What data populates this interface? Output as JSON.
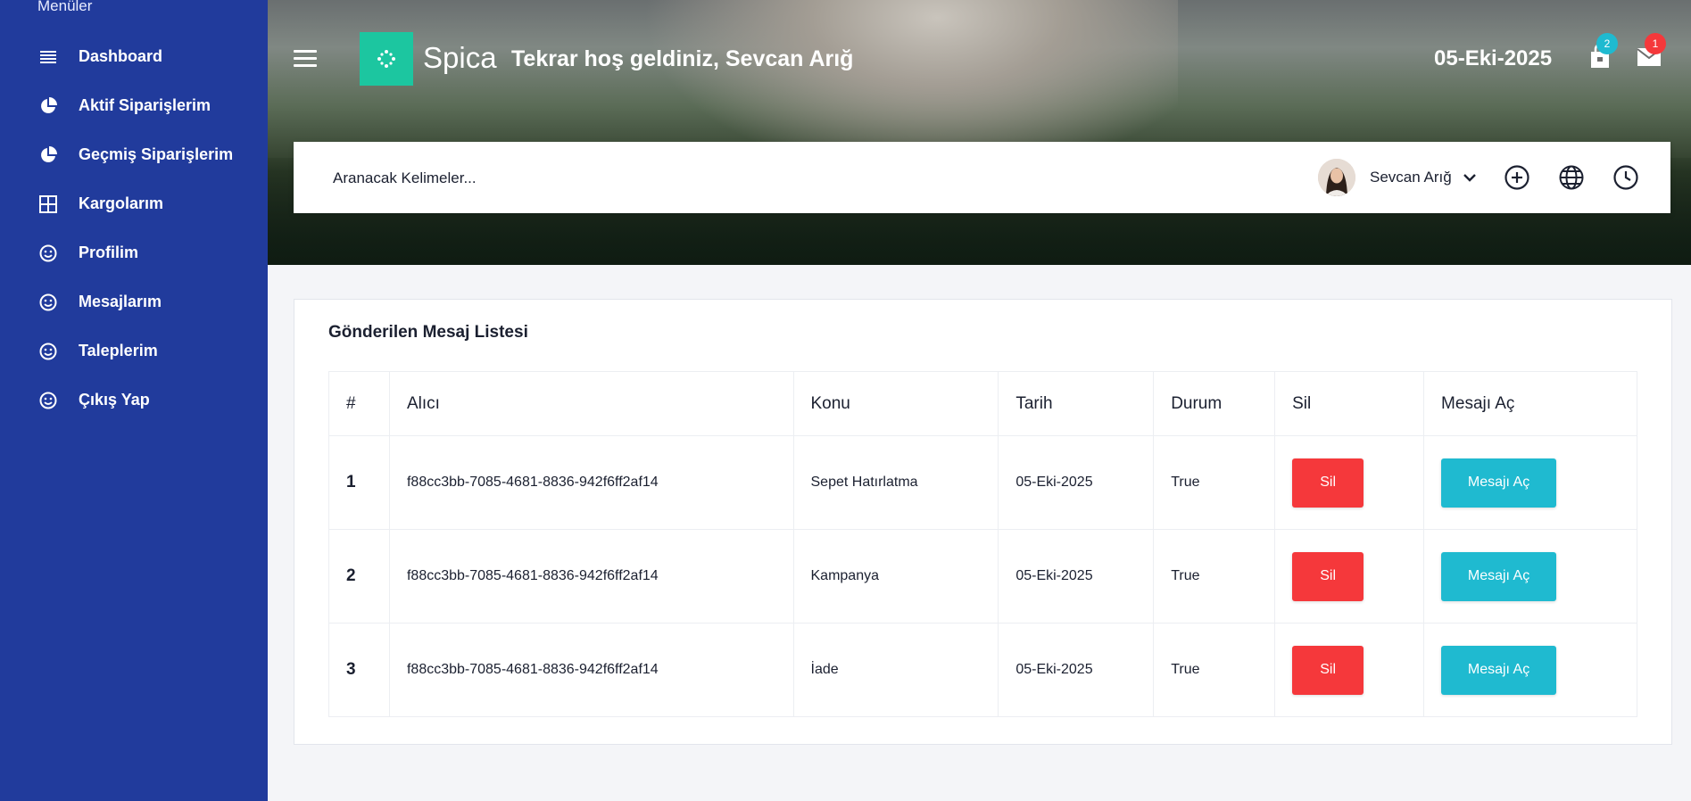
{
  "sidebar": {
    "title": "Menüler",
    "items": [
      {
        "label": "Dashboard",
        "icon": "list-icon"
      },
      {
        "label": "Aktif Siparişlerim",
        "icon": "pie-chart-icon"
      },
      {
        "label": "Geçmiş Siparişlerim",
        "icon": "pie-chart-icon"
      },
      {
        "label": "Kargolarım",
        "icon": "grid-icon"
      },
      {
        "label": "Profilim",
        "icon": "smile-icon"
      },
      {
        "label": "Mesajlarım",
        "icon": "smile-icon"
      },
      {
        "label": "Taleplerim",
        "icon": "smile-icon"
      },
      {
        "label": "Çıkış Yap",
        "icon": "smile-icon"
      }
    ]
  },
  "header": {
    "brand": "Spica",
    "welcome": "Tekrar hoş geldiniz, Sevcan Arığ",
    "date": "05-Eki-2025",
    "cart_badge": "2",
    "mail_badge": "1",
    "colors": {
      "brand_green": "#1cc6a0",
      "cart_badge": "#1fbad0",
      "mail_badge": "#f5383b"
    }
  },
  "search": {
    "placeholder": "Aranacak Kelimeler...",
    "user_name": "Sevcan Arığ"
  },
  "card": {
    "title": "Gönderilen Mesaj Listesi",
    "columns": [
      "#",
      "Alıcı",
      "Konu",
      "Tarih",
      "Durum",
      "Sil",
      "Mesajı Aç"
    ],
    "rows": [
      {
        "num": "1",
        "recipient": "f88cc3bb-7085-4681-8836-942f6ff2af14",
        "subject": "Sepet Hatırlatma",
        "date": "05-Eki-2025",
        "status": "True",
        "delete": "Sil",
        "open": "Mesajı Aç"
      },
      {
        "num": "2",
        "recipient": "f88cc3bb-7085-4681-8836-942f6ff2af14",
        "subject": "Kampanya",
        "date": "05-Eki-2025",
        "status": "True",
        "delete": "Sil",
        "open": "Mesajı Aç"
      },
      {
        "num": "3",
        "recipient": "f88cc3bb-7085-4681-8836-942f6ff2af14",
        "subject": "İade",
        "date": "05-Eki-2025",
        "status": "True",
        "delete": "Sil",
        "open": "Mesajı Aç"
      }
    ]
  },
  "colors": {
    "sidebar": "#213b9c",
    "delete_button": "#f5383b",
    "open_button": "#1fbad0"
  }
}
